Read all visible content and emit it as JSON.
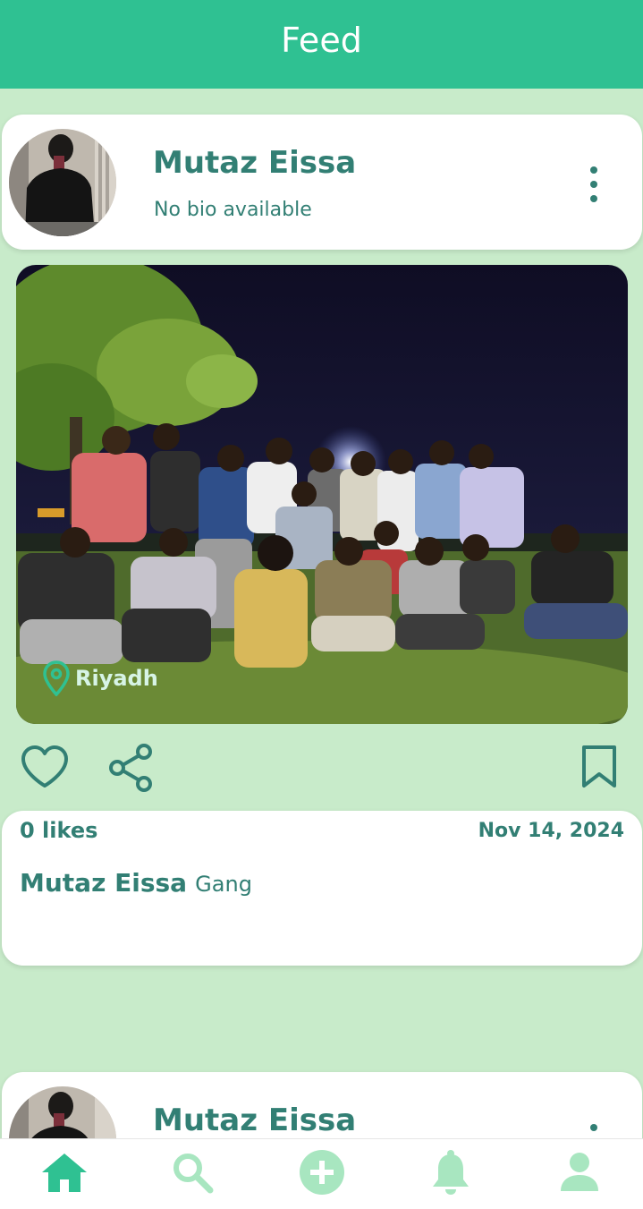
{
  "appbar": {
    "title": "Feed"
  },
  "post": {
    "user_name": "Mutaz Eissa",
    "bio": "No bio available",
    "location": "Riyadh",
    "likes": "0 likes",
    "date": "Nov 14, 2024",
    "caption_user": "Mutaz Eissa",
    "caption_text": "Gang"
  },
  "next_post": {
    "user_name": "Mutaz Eissa"
  },
  "bottom_nav": {
    "items": [
      "home-icon",
      "search-icon",
      "add-icon",
      "notifications-icon",
      "profile-icon"
    ],
    "active": "home-icon"
  },
  "colors": {
    "primary": "#2fc192",
    "background": "#c8ebca",
    "text": "#327f74",
    "inactive_icon": "#a8e6c0"
  }
}
